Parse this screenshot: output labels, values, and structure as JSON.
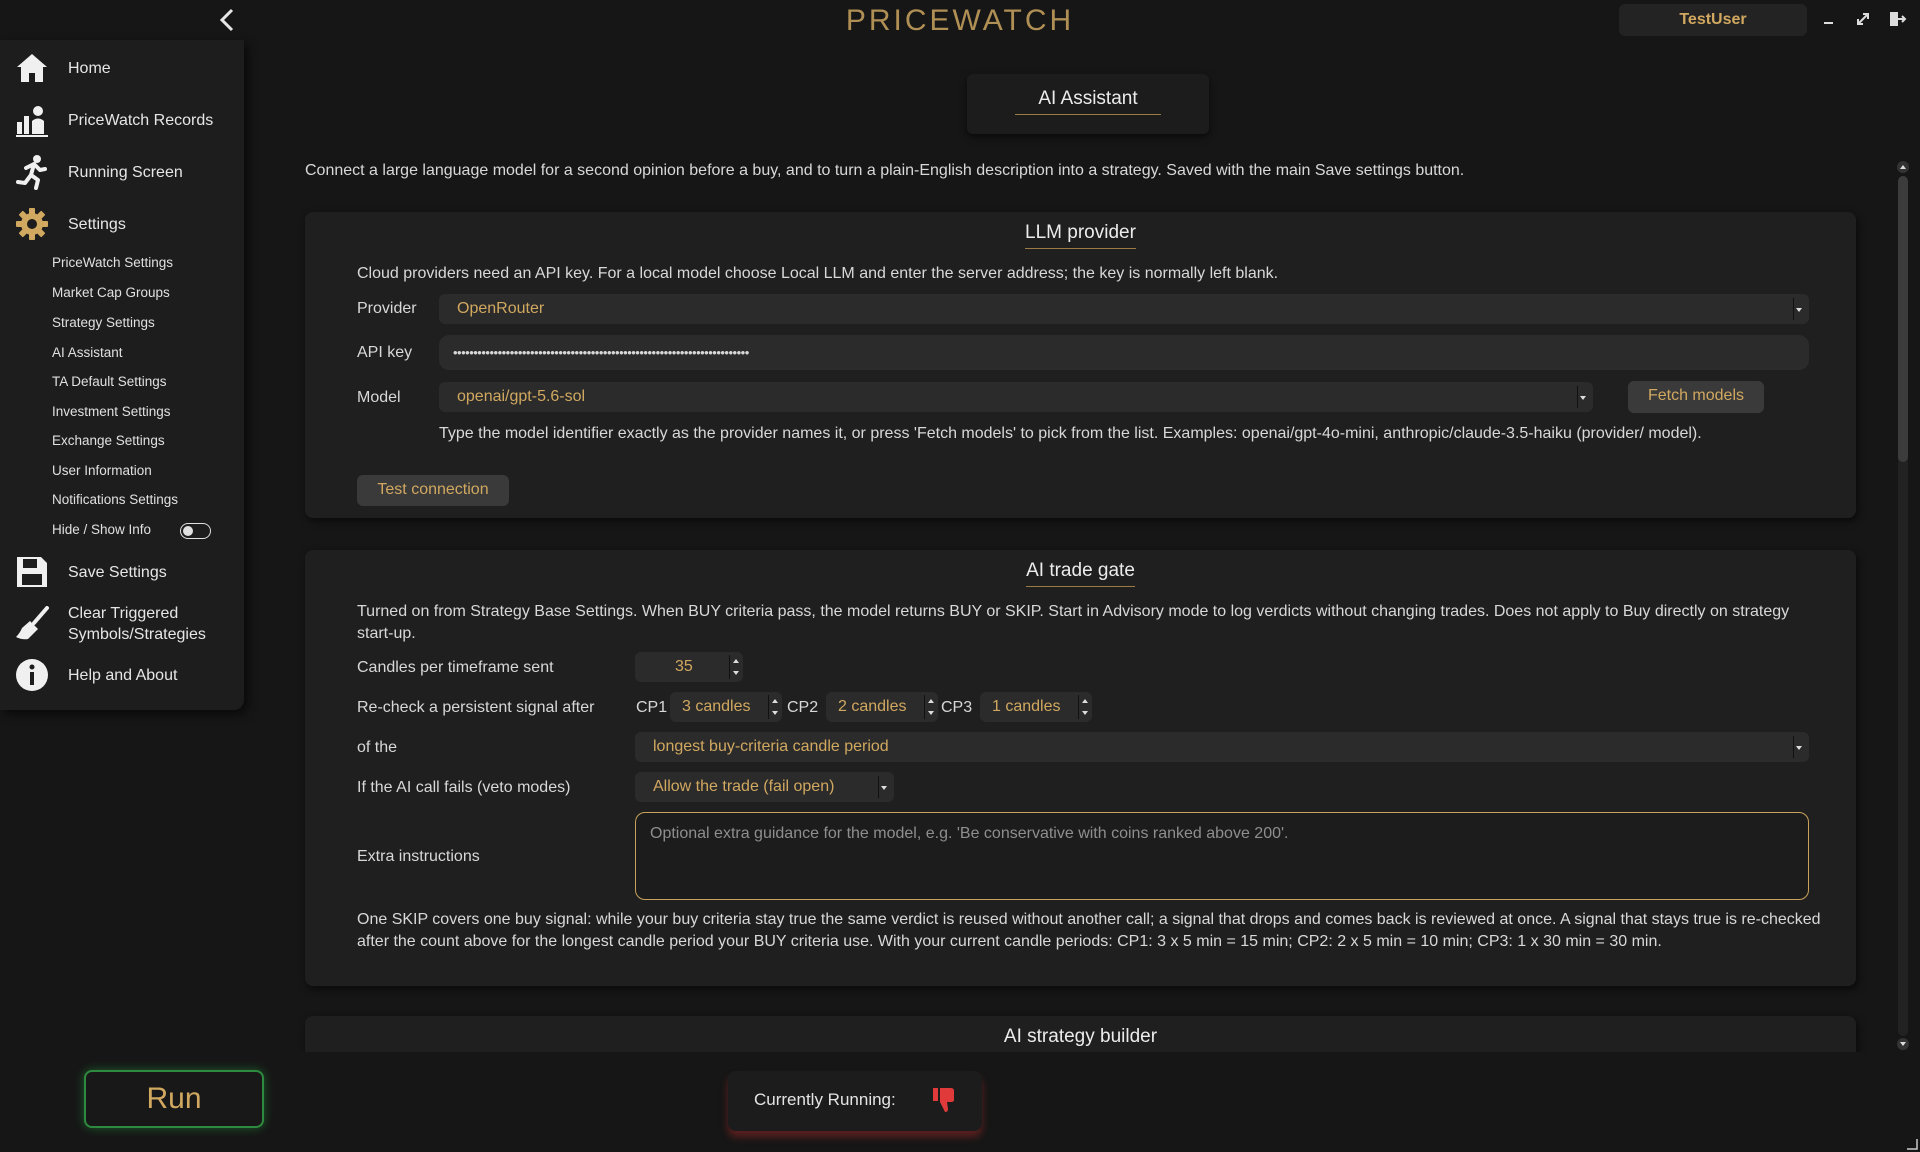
{
  "app": {
    "title": "PRICEWATCH",
    "user": "TestUser"
  },
  "sidebar": {
    "main_items": [
      {
        "label": "Home",
        "icon": "home-icon"
      },
      {
        "label": "PriceWatch Records",
        "icon": "records-icon"
      },
      {
        "label": "Running Screen",
        "icon": "running-icon"
      },
      {
        "label": "Settings",
        "icon": "gear-icon"
      }
    ],
    "settings_items": [
      "PriceWatch Settings",
      "Market Cap Groups",
      "Strategy Settings",
      "AI Assistant",
      "TA Default Settings",
      "Investment Settings",
      "Exchange Settings",
      "User Information",
      "Notifications Settings"
    ],
    "active_settings_item": "AI Assistant",
    "hide_show_label": "Hide / Show Info",
    "bottom_items": [
      {
        "label": "Save Settings",
        "icon": "save-icon"
      },
      {
        "label": "Clear Triggered Symbols/Strategies",
        "icon": "broom-icon"
      },
      {
        "label": "Help and About",
        "icon": "info-icon"
      }
    ]
  },
  "main": {
    "page_title": "AI Assistant",
    "intro": "Connect a large language model for a second opinion before a buy, and to turn a plain-English description into a strategy. Saved with the main Save settings button.",
    "llm": {
      "title": "LLM provider",
      "desc": "Cloud providers need an API key. For a local model choose Local LLM and enter the server address; the key is normally left blank.",
      "provider_label": "Provider",
      "provider_value": "OpenRouter",
      "api_key_label": "API key",
      "api_key_value": "•••••••••••••••••••••••••••••••••••••••••••••••••••••••••••••••••••••••••",
      "model_label": "Model",
      "model_value": "openai/gpt-5.6-sol",
      "fetch_button": "Fetch models",
      "model_hint": "Type the model identifier exactly as the provider names it, or press 'Fetch models' to pick from the list. Examples: openai/gpt-4o-mini, anthropic/claude-3.5-haiku (provider/ model).",
      "test_button": "Test connection"
    },
    "gate": {
      "title": "AI trade gate",
      "desc": "Turned on from Strategy Base Settings. When BUY criteria pass, the model returns BUY or SKIP. Start in Advisory mode to log verdicts without changing trades. Does not apply to Buy directly on strategy start-up.",
      "candles_label": "Candles per timeframe sent",
      "candles_value": "35",
      "recheck_label": "Re-check a persistent signal after",
      "cp1_label": "CP1",
      "cp1_value": "3 candles",
      "cp2_label": "CP2",
      "cp2_value": "2 candles",
      "cp3_label": "CP3",
      "cp3_value": "1 candles",
      "of_the_label": "of the",
      "of_the_value": "longest buy-criteria candle period",
      "fail_label": "If the AI call fails (veto modes)",
      "fail_value": "Allow the trade (fail open)",
      "extra_label": "Extra instructions",
      "extra_placeholder": "Optional extra guidance for the model, e.g. 'Be conservative with coins ranked above 200'.",
      "footer": "One SKIP covers one buy signal: while your buy criteria stay true the same verdict is reused without another call; a signal that drops and comes back is reviewed at once. A signal that stays true is re-checked after the count above for the longest candle period your BUY criteria use. With your current candle periods: CP1: 3 x 5 min = 15 min;  CP2: 2 x 5 min = 10 min; CP3: 1 x 30 min = 30 min."
    },
    "builder": {
      "title": "AI strategy builder"
    }
  },
  "footer": {
    "run_button": "Run",
    "currently_running_label": "Currently Running:",
    "running_status_icon": "thumbs-down-icon"
  },
  "colors": {
    "accent": "#d1a860",
    "running_off": "#e03a3a",
    "run_glow": "#2e8a3e"
  }
}
